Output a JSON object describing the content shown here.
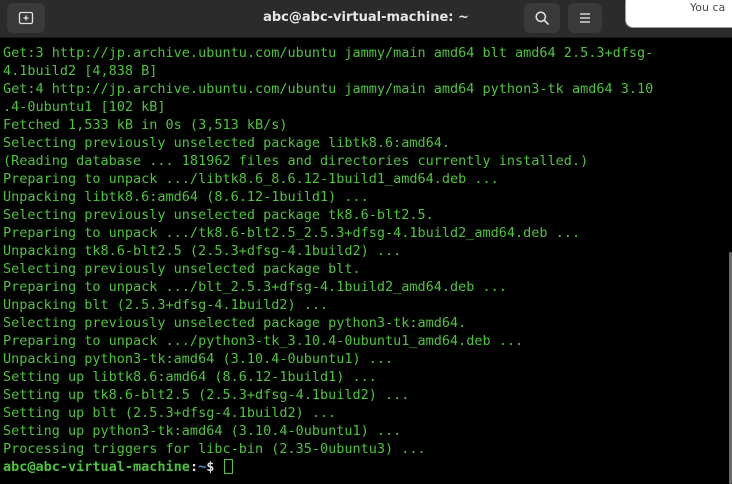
{
  "window": {
    "title": "abc@abc-virtual-machine: ~",
    "background_window_text": "You ca"
  },
  "colors": {
    "terminal_text": "#4ec43a",
    "prompt_path": "#4a8fd8",
    "titlebar": "#2b2b2b"
  },
  "icons": {
    "new_tab": "new-tab-icon",
    "search": "search-icon",
    "menu": "hamburger-menu-icon"
  },
  "terminal": {
    "lines": [
      "Get:3 http://jp.archive.ubuntu.com/ubuntu jammy/main amd64 blt amd64 2.5.3+dfsg-",
      "4.1build2 [4,838 B]",
      "Get:4 http://jp.archive.ubuntu.com/ubuntu jammy/main amd64 python3-tk amd64 3.10",
      ".4-0ubuntu1 [102 kB]",
      "Fetched 1,533 kB in 0s (3,513 kB/s)",
      "Selecting previously unselected package libtk8.6:amd64.",
      "(Reading database ... 181962 files and directories currently installed.)",
      "Preparing to unpack .../libtk8.6_8.6.12-1build1_amd64.deb ...",
      "Unpacking libtk8.6:amd64 (8.6.12-1build1) ...",
      "Selecting previously unselected package tk8.6-blt2.5.",
      "Preparing to unpack .../tk8.6-blt2.5_2.5.3+dfsg-4.1build2_amd64.deb ...",
      "Unpacking tk8.6-blt2.5 (2.5.3+dfsg-4.1build2) ...",
      "Selecting previously unselected package blt.",
      "Preparing to unpack .../blt_2.5.3+dfsg-4.1build2_amd64.deb ...",
      "Unpacking blt (2.5.3+dfsg-4.1build2) ...",
      "Selecting previously unselected package python3-tk:amd64.",
      "Preparing to unpack .../python3-tk_3.10.4-0ubuntu1_amd64.deb ...",
      "Unpacking python3-tk:amd64 (3.10.4-0ubuntu1) ...",
      "Setting up libtk8.6:amd64 (8.6.12-1build1) ...",
      "Setting up tk8.6-blt2.5 (2.5.3+dfsg-4.1build2) ...",
      "Setting up blt (2.5.3+dfsg-4.1build2) ...",
      "Setting up python3-tk:amd64 (3.10.4-0ubuntu1) ...",
      "Processing triggers for libc-bin (2.35-0ubuntu3) ..."
    ],
    "prompt": {
      "user_host": "abc@abc-virtual-machine",
      "separator": ":",
      "path": "~",
      "symbol": "$ "
    }
  }
}
